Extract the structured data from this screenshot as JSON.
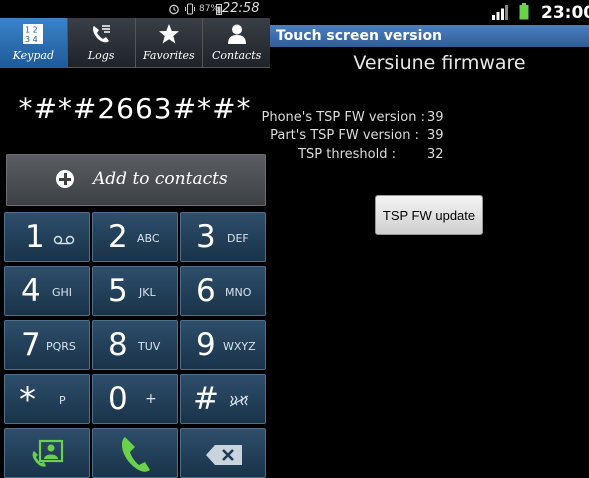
{
  "left_status": {
    "battery_pct": "87%",
    "time": "22:58"
  },
  "tabs": [
    {
      "label": "Keypad",
      "icon": "keypad-icon",
      "active": true
    },
    {
      "label": "Logs",
      "icon": "call-log-icon",
      "active": false
    },
    {
      "label": "Favorites",
      "icon": "star-icon",
      "active": false
    },
    {
      "label": "Contacts",
      "icon": "person-icon",
      "active": false
    }
  ],
  "dialer": {
    "number": "*#*#2663#*#*",
    "add_to_contacts": "Add to contacts"
  },
  "keypad": [
    {
      "digit": "1",
      "letters": ""
    },
    {
      "digit": "2",
      "letters": "ABC"
    },
    {
      "digit": "3",
      "letters": "DEF"
    },
    {
      "digit": "4",
      "letters": "GHI"
    },
    {
      "digit": "5",
      "letters": "JKL"
    },
    {
      "digit": "6",
      "letters": "MNO"
    },
    {
      "digit": "7",
      "letters": "PQRS"
    },
    {
      "digit": "8",
      "letters": "TUV"
    },
    {
      "digit": "9",
      "letters": "WXYZ"
    },
    {
      "digit": "*",
      "letters": "P"
    },
    {
      "digit": "0",
      "letters": "+"
    },
    {
      "digit": "#",
      "letters": ""
    }
  ],
  "bottom_icons": [
    "video-call-icon",
    "phone-call-icon",
    "backspace-icon"
  ],
  "right_status": {
    "time": "23:00"
  },
  "right": {
    "title": "Touch screen version",
    "heading": "Versiune firmware",
    "phone_tsp_label": "Phone's TSP FW version :",
    "phone_tsp_value": "39",
    "part_tsp_label": "Part's TSP FW version :",
    "part_tsp_value": "39",
    "threshold_label": "TSP threshold :",
    "threshold_value": "32",
    "update_button": "TSP FW update"
  }
}
